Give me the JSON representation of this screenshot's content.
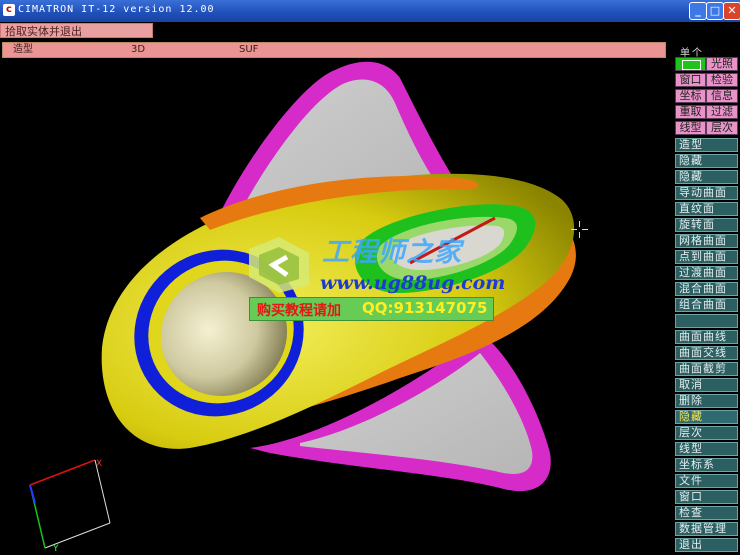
{
  "window": {
    "title": "CIMATRON IT-12 version 12.00",
    "app_icon": "cimatron-logo-icon",
    "buttons": {
      "minimize": "_",
      "maximize": "□",
      "close": "✕"
    },
    "close_color": "#d9442a",
    "title_bar_color": "#2a5cc6"
  },
  "command": {
    "label": "拾取实体并退出"
  },
  "status": {
    "mode": "造型",
    "dimension": "3D",
    "entity": "SUF"
  },
  "side_menu": {
    "title": "单个",
    "toggle": {
      "color": "#21c21a",
      "label": "光照"
    },
    "grid_rows": [
      [
        "窗口",
        "检验"
      ],
      [
        "坐标",
        "信息"
      ],
      [
        "重取",
        "过滤"
      ],
      [
        "线型",
        "层次"
      ]
    ],
    "items": [
      {
        "label": "造型"
      },
      {
        "label": "隐藏"
      },
      {
        "label": "隐藏"
      },
      {
        "label": "导动曲面"
      },
      {
        "label": "直纹面"
      },
      {
        "label": "旋转面"
      },
      {
        "label": "网格曲面"
      },
      {
        "label": "点到曲面"
      },
      {
        "label": "过渡曲面"
      },
      {
        "label": "混合曲面"
      },
      {
        "label": "组合曲面"
      },
      {
        "label": ""
      },
      {
        "label": "曲面曲线"
      },
      {
        "label": "曲面交线"
      },
      {
        "label": "曲面截剪"
      },
      {
        "label": "取消"
      },
      {
        "label": "删除"
      },
      {
        "label": "隐藏",
        "active": true
      },
      {
        "label": "层次"
      },
      {
        "label": "线型"
      },
      {
        "label": "坐标系"
      },
      {
        "label": "文件"
      },
      {
        "label": "窗口"
      },
      {
        "label": "检查"
      },
      {
        "label": "数据管理"
      },
      {
        "label": "退出"
      }
    ]
  },
  "watermark": {
    "site_name": "工程师之家",
    "url": "www.ug88ug.com",
    "banner_text": "购买教程请加",
    "qq": "QQ:913147075"
  },
  "axes": {
    "x_label": "X",
    "y_label": "Y"
  },
  "colors": {
    "body_yellow": "#e0d61c",
    "fin_magenta": "#d62bc8",
    "fin_gray": "#c8c8c8",
    "trim_orange": "#e67a10",
    "window_blue": "#1020d8",
    "window_green": "#1ec01e",
    "sphere": "#d6d2a0"
  }
}
